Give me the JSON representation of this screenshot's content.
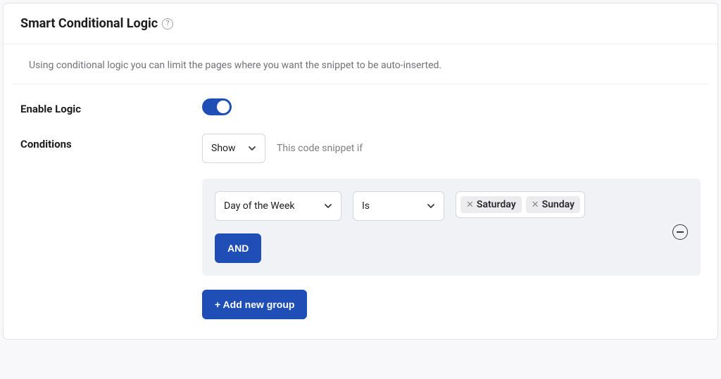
{
  "header": {
    "title": "Smart Conditional Logic"
  },
  "description": "Using conditional logic you can limit the pages where you want the snippet to be auto-inserted.",
  "labels": {
    "enable_logic": "Enable Logic",
    "conditions": "Conditions"
  },
  "action_select": {
    "value": "Show"
  },
  "hint_text": "This code snippet if",
  "group": {
    "rule": {
      "field": "Day of the Week",
      "operator": "Is",
      "values": [
        "Saturday",
        "Sunday"
      ]
    },
    "and_label": "AND"
  },
  "add_group_label": "+ Add new group"
}
